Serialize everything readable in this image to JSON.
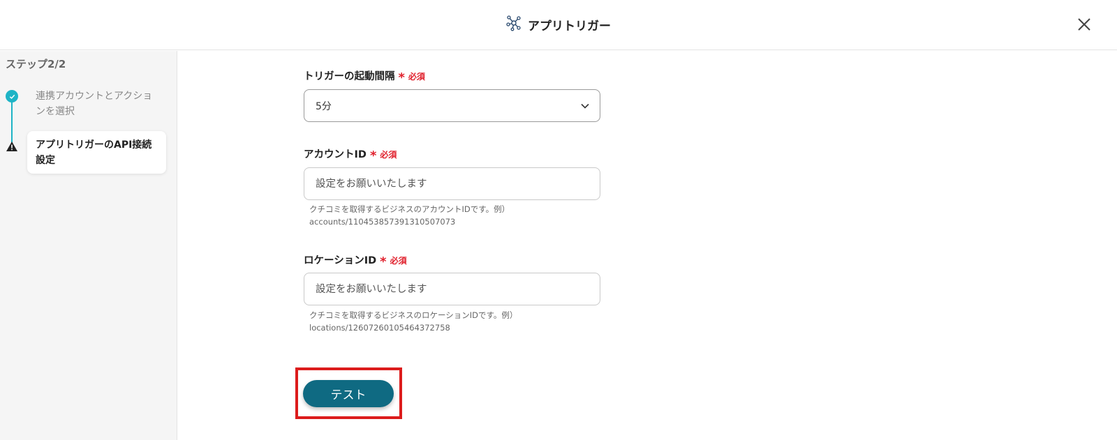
{
  "header": {
    "title": "アプリトリガー",
    "icon": "app-trigger-network-icon"
  },
  "sidebar": {
    "step_count": "ステップ2/2",
    "steps": [
      {
        "label": "連携アカウントとアクションを選択",
        "status": "completed"
      },
      {
        "label": "アプリトリガーのAPI接続設定",
        "status": "current"
      }
    ]
  },
  "form": {
    "interval": {
      "label": "トリガーの起動間隔",
      "required": "必須",
      "value": "5分"
    },
    "account_id": {
      "label": "アカウントID",
      "required": "必須",
      "placeholder": "設定をお願いいたします",
      "hint_line1": "クチコミを取得するビジネスのアカウントIDです。例）",
      "hint_line2": "accounts/110453857391310507073"
    },
    "location_id": {
      "label": "ロケーションID",
      "required": "必須",
      "placeholder": "設定をお願いいたします",
      "hint_line1": "クチコミを取得するビジネスのロケーションIDです。例）",
      "hint_line2": "locations/12607260105464372758"
    }
  },
  "actions": {
    "test_label": "テスト"
  },
  "colors": {
    "accent": "#0f6a82",
    "step_done": "#1eb4c6",
    "required": "#e0202c",
    "highlight": "#dc1c1c"
  }
}
